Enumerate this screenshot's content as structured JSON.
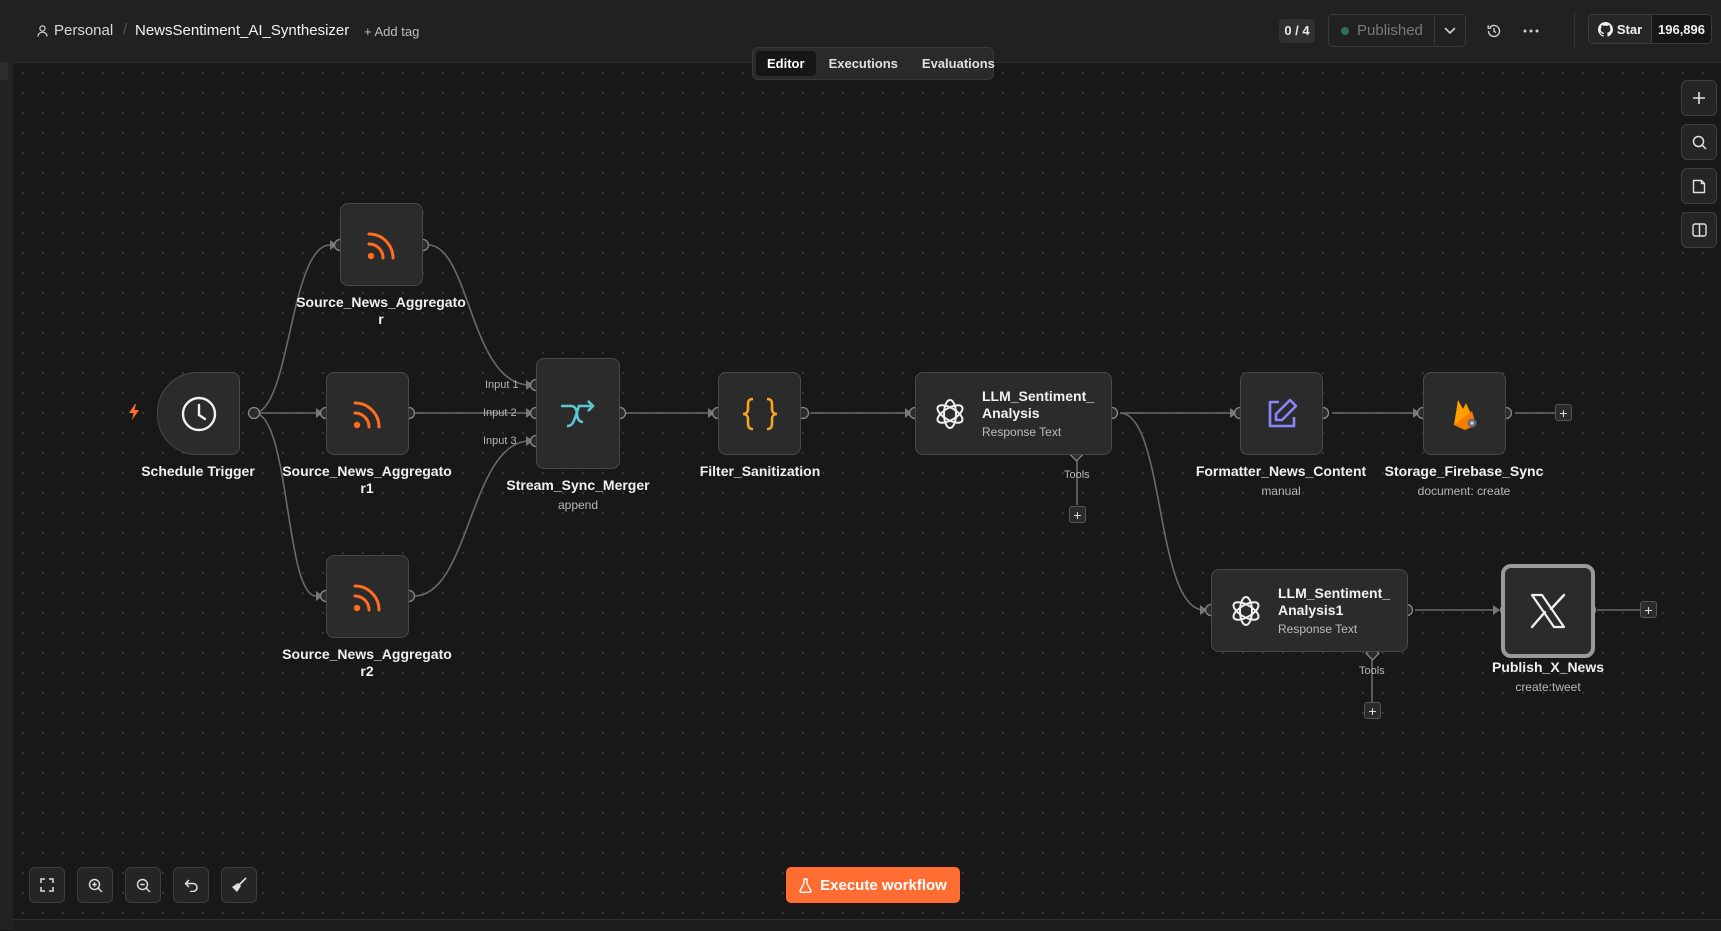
{
  "header": {
    "project": "Personal",
    "workflow_name": "NewsSentiment_AI_Synthesizer",
    "add_tag": "+ Add tag",
    "counter": "0 / 4",
    "publish_status": "Published",
    "github_star": "Star",
    "github_count": "196,896"
  },
  "tabs": [
    {
      "label": "Editor",
      "active": true
    },
    {
      "label": "Executions"
    },
    {
      "label": "Evaluations"
    }
  ],
  "nodes": {
    "schedule": {
      "label": "Schedule Trigger"
    },
    "news1": {
      "label": "Source_News_Aggregato\nr"
    },
    "news2": {
      "label": "Source_News_Aggregato\nr1"
    },
    "news3": {
      "label": "Source_News_Aggregato\nr2"
    },
    "merger": {
      "label": "Stream_Sync_Merger",
      "sub": "append",
      "inputs": [
        "Input 1",
        "Input 2",
        "Input 3"
      ]
    },
    "filter": {
      "label": "Filter_Sanitization"
    },
    "llm1": {
      "title": "LLM_Sentiment_\nAnalysis",
      "sub": "Response Text",
      "tools": "Tools"
    },
    "formatter": {
      "label": "Formatter_News_Content",
      "sub": "manual"
    },
    "storage": {
      "label": "Storage_Firebase_Sync",
      "sub": "document: create"
    },
    "llm2": {
      "title": "LLM_Sentiment_\nAnalysis1",
      "sub": "Response Text",
      "tools": "Tools"
    },
    "publish": {
      "label": "Publish_X_News",
      "sub": "create:tweet"
    }
  },
  "execute_label": "Execute workflow",
  "colors": {
    "accent": "#ff6d33",
    "rss": "#ff6d1f",
    "merge": "#5bc8cf",
    "filter": "#f5a623",
    "edit": "#8a84ff",
    "firebase": "#ffa000"
  }
}
